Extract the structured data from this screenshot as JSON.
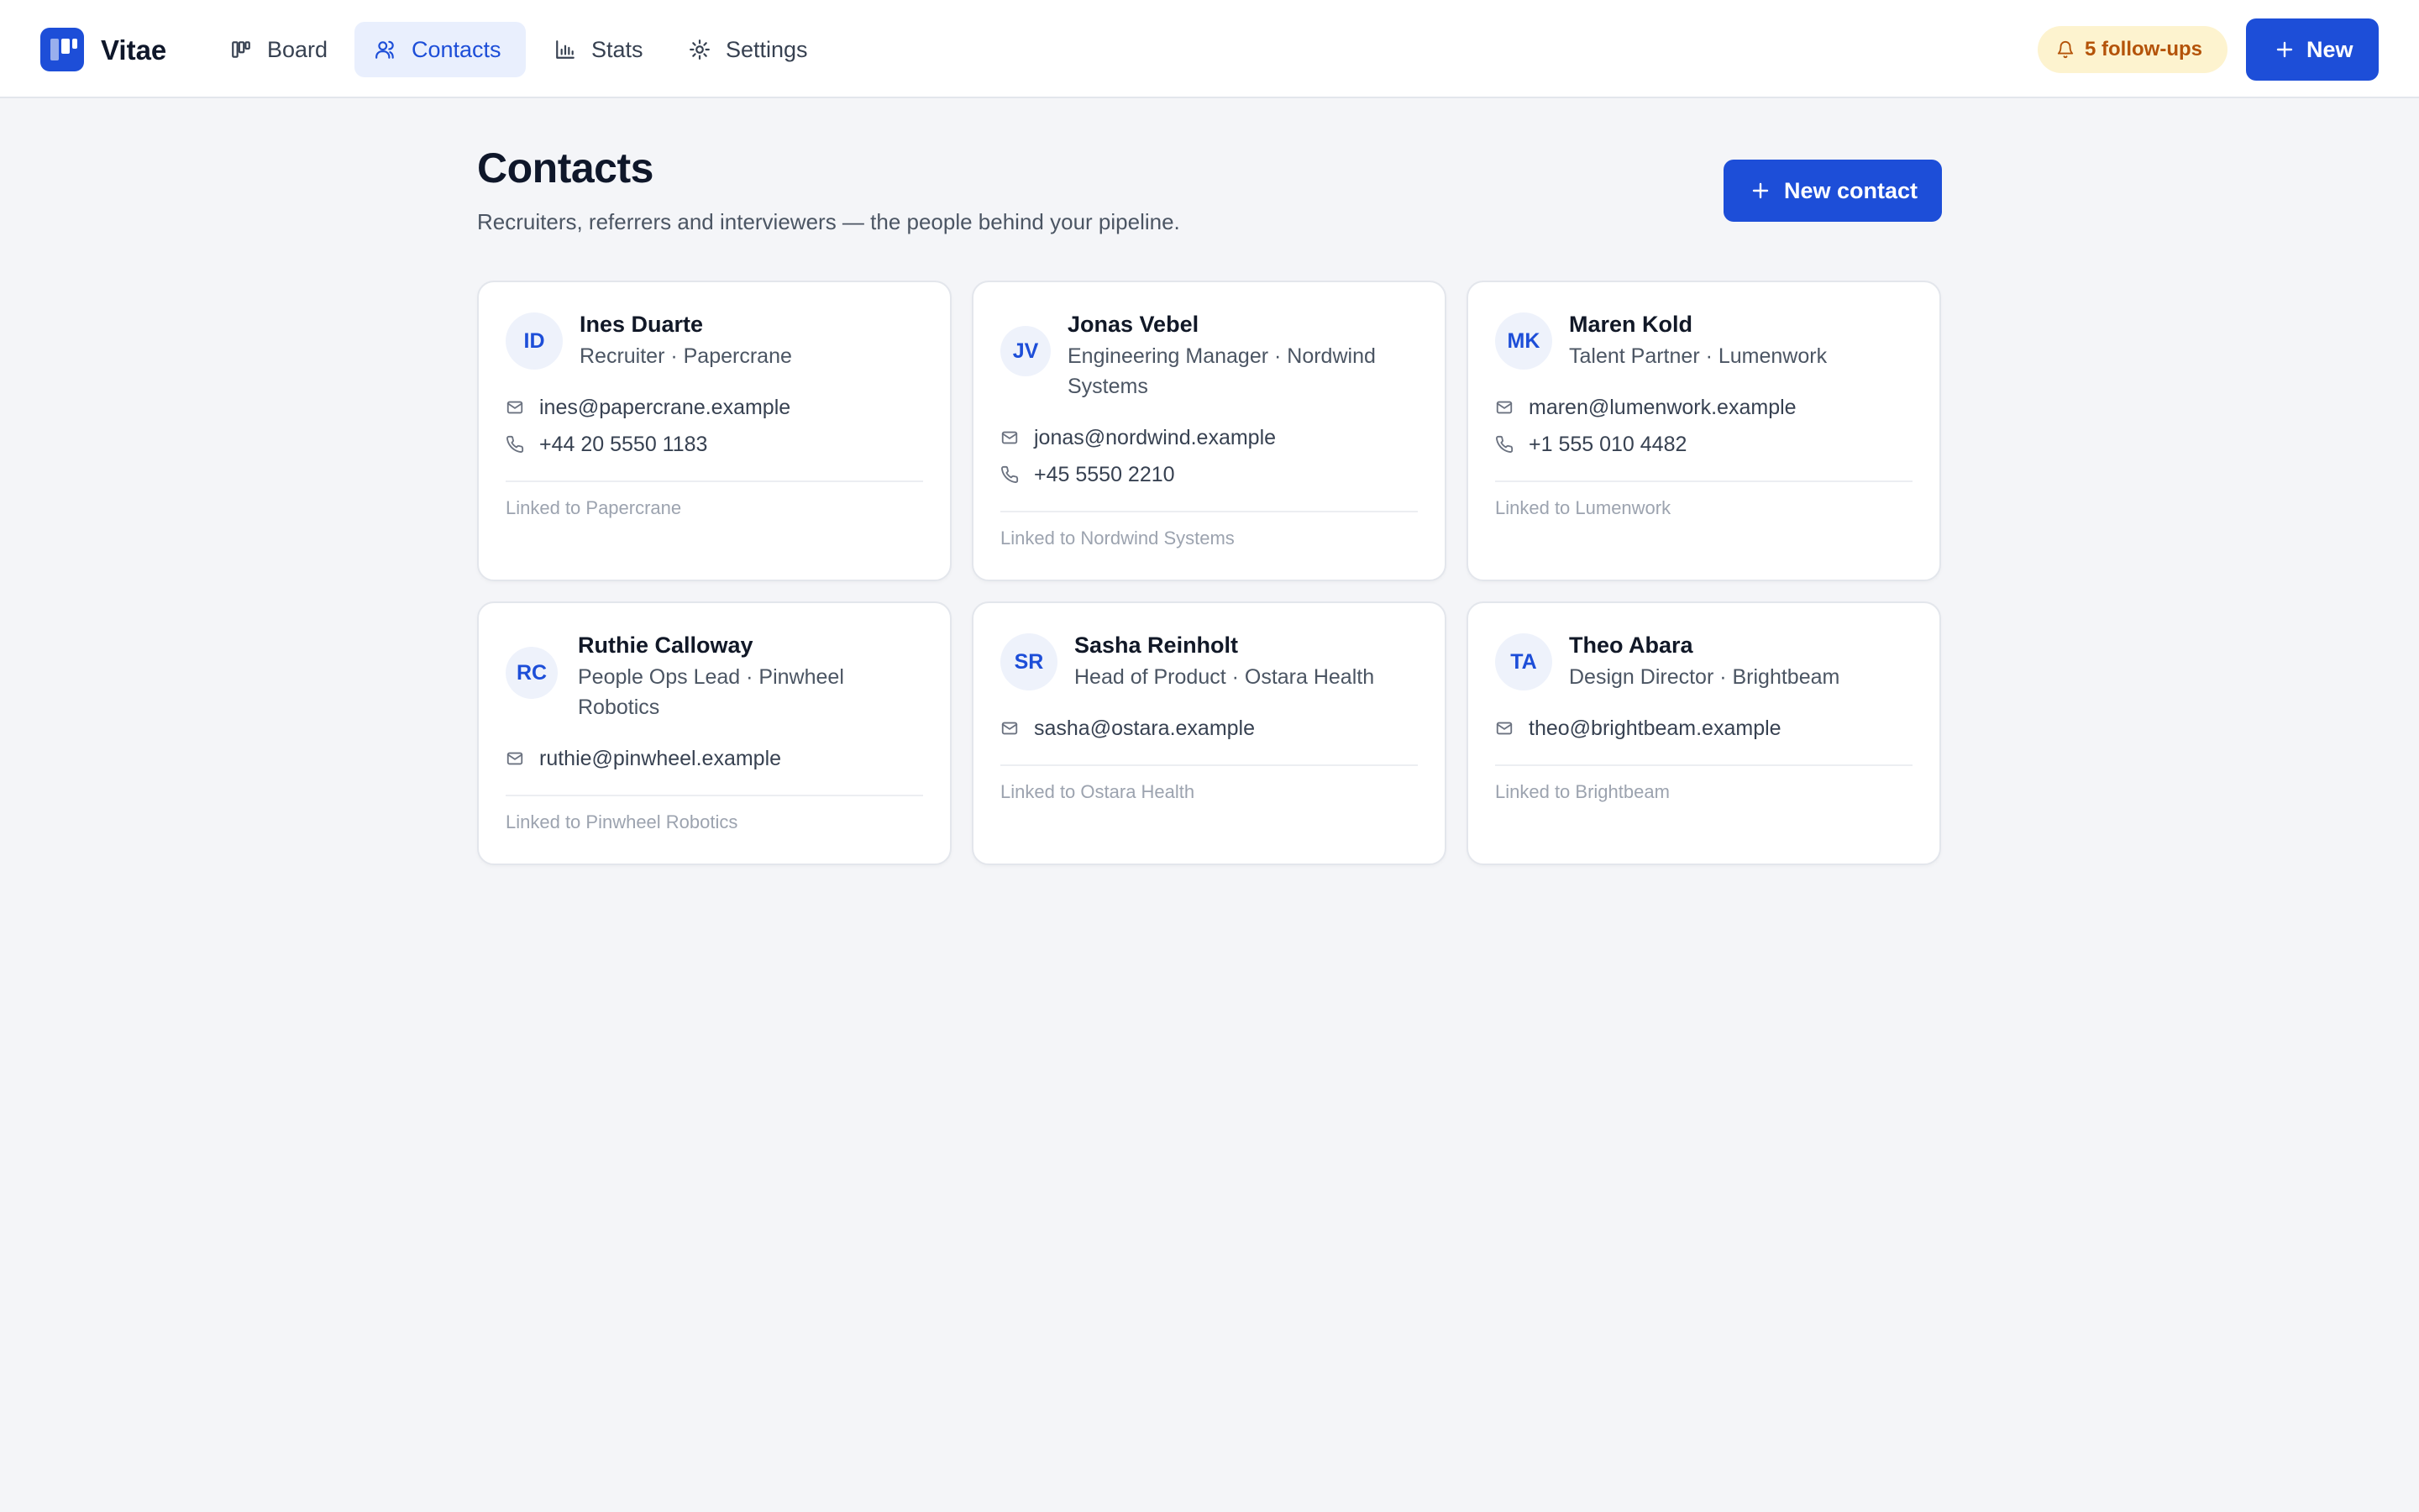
{
  "app": {
    "name": "Vitae"
  },
  "nav": {
    "items": [
      {
        "label": "Board",
        "icon": "board-icon",
        "active": false
      },
      {
        "label": "Contacts",
        "icon": "users-icon",
        "active": true
      },
      {
        "label": "Stats",
        "icon": "bar-chart-icon",
        "active": false
      },
      {
        "label": "Settings",
        "icon": "gear-icon",
        "active": false
      }
    ]
  },
  "header": {
    "followups_label": "5 follow-ups",
    "new_label": "New"
  },
  "page": {
    "title": "Contacts",
    "subtitle": "Recruiters, referrers and interviewers — the people behind your pipeline.",
    "new_contact_label": "New contact"
  },
  "contacts": [
    {
      "initials": "ID",
      "name": "Ines Duarte",
      "role": "Recruiter · Papercrane",
      "email": "ines@papercrane.example",
      "phone": "+44 20 5550 1183",
      "linked": "Linked to Papercrane"
    },
    {
      "initials": "JV",
      "name": "Jonas Vebel",
      "role": "Engineering Manager · Nordwind Systems",
      "email": "jonas@nordwind.example",
      "phone": "+45 5550 2210",
      "linked": "Linked to Nordwind Systems"
    },
    {
      "initials": "MK",
      "name": "Maren Kold",
      "role": "Talent Partner · Lumenwork",
      "email": "maren@lumenwork.example",
      "phone": "+1 555 010 4482",
      "linked": "Linked to Lumenwork"
    },
    {
      "initials": "RC",
      "name": "Ruthie Calloway",
      "role": "People Ops Lead · Pinwheel Robotics",
      "email": "ruthie@pinwheel.example",
      "linked": "Linked to Pinwheel Robotics"
    },
    {
      "initials": "SR",
      "name": "Sasha Reinholt",
      "role": "Head of Product · Ostara Health",
      "email": "sasha@ostara.example",
      "linked": "Linked to Ostara Health"
    },
    {
      "initials": "TA",
      "name": "Theo Abara",
      "role": "Design Director · Brightbeam",
      "email": "theo@brightbeam.example",
      "linked": "Linked to Brightbeam"
    }
  ],
  "colors": {
    "accent": "#1d4ed8",
    "background": "#f4f5f8",
    "followups_bg": "#fdf3cf",
    "followups_text": "#b45309"
  }
}
